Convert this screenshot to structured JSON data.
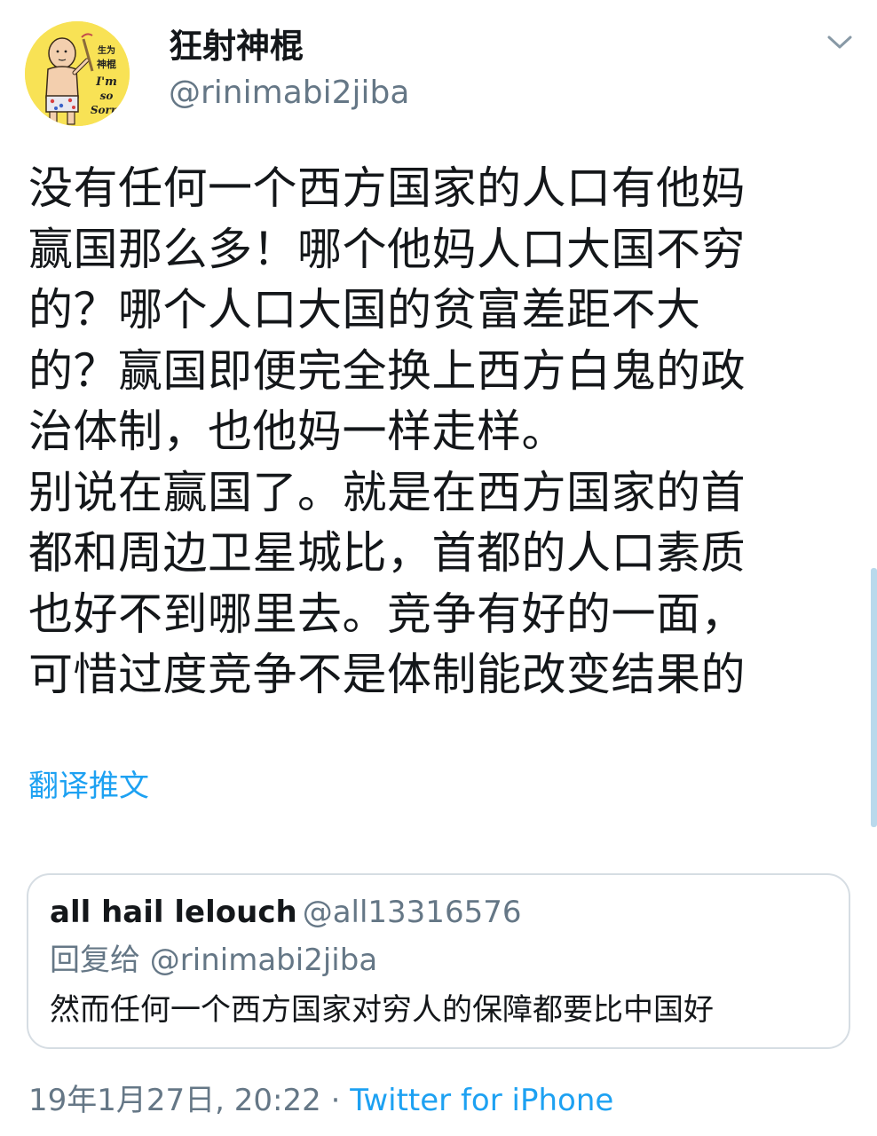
{
  "author": {
    "avatar_text": [
      "生为",
      "神棍",
      "I'm",
      "so",
      "Sorry"
    ],
    "display_name": "狂射神棍",
    "handle": "@rinimabi2jiba"
  },
  "icons": {
    "more": "chevron-down-icon"
  },
  "tweet": {
    "text": "没有任何一个西方国家的人口有他妈\n赢国那么多！哪个他妈人口大国不穷\n的？哪个人口大国的贫富差距不大\n的？赢国即便完全换上西方白鬼的政\n治体制，也他妈一样走样。\n别说在赢国了。就是在西方国家的首\n都和周边卫星城比，首都的人口素质\n也好不到哪里去。竞争有好的一面，\n可惜过度竞争不是体制能改变结果的",
    "translate_label": "翻译推文"
  },
  "quoted": {
    "name": "all hail lelouch",
    "handle": "@all13316576",
    "reply_to": "回复给 @rinimabi2jiba",
    "text": "然而任何一个西方国家对穷人的保障都要比中国好"
  },
  "meta": {
    "timestamp": "19年1月27日, 20:22",
    "separator": " · ",
    "source": "Twitter for iPhone"
  },
  "colors": {
    "link": "#1da1f2",
    "secondary_text": "#657786",
    "primary_text": "#14171a",
    "border": "#d6dde3",
    "avatar_bg": "#f8e255"
  }
}
